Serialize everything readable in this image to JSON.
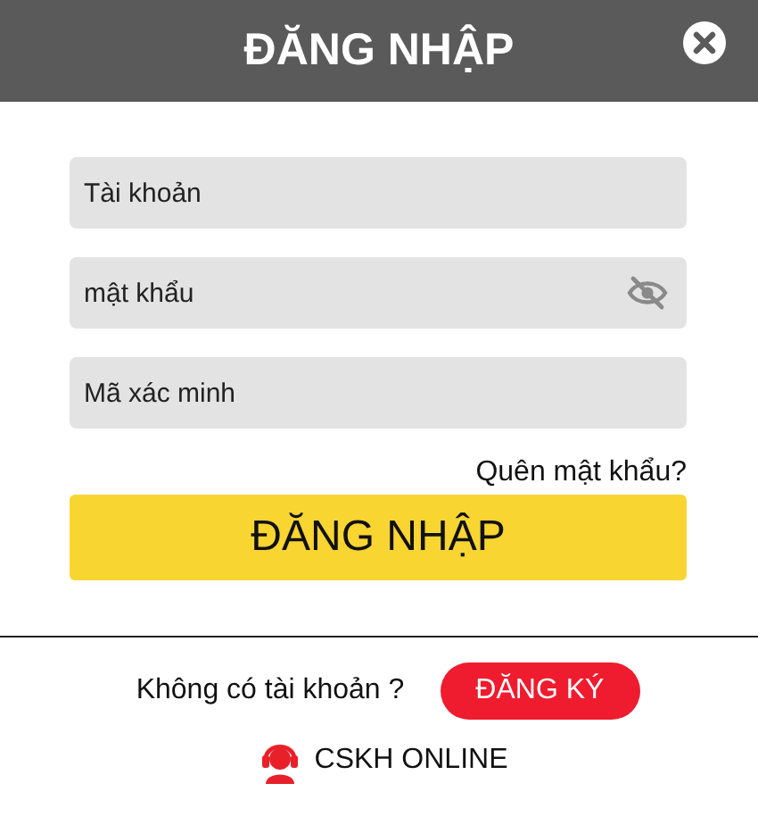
{
  "dialog": {
    "title": "ĐĂNG NHẬP"
  },
  "fields": [
    {
      "kind": "text",
      "placeholder": "Tài khoản"
    },
    {
      "kind": "password",
      "placeholder": "mật khẩu",
      "password_visible": false
    },
    {
      "kind": "text",
      "placeholder": "Mã xác minh"
    }
  ],
  "forgot_link": "Quên mật khẩu?",
  "login_button": "ĐĂNG NHẬP",
  "register": {
    "prompt": "Không có tài khoản ?",
    "button": "ĐĂNG KÝ"
  },
  "support_link": "CSKH ONLINE"
}
